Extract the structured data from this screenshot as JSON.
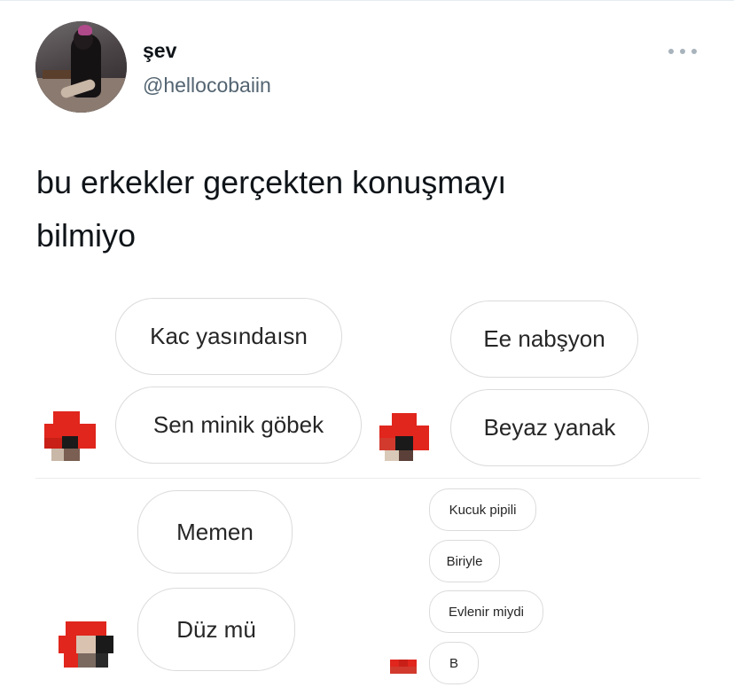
{
  "tweet": {
    "display_name": "şev",
    "handle": "@hellocobaiin",
    "text": "bu erkekler gerçekten konuşmayı\nbilmiyo",
    "more_icon": "more-horizontal-icon"
  },
  "screenshots": {
    "top_left": [
      "Kac yasındaısn",
      "Sen minik göbek"
    ],
    "top_right": [
      "Ee nabşyon",
      "Beyaz yanak"
    ],
    "bottom_left": [
      "Memen",
      "Düz mü"
    ],
    "bottom_right": [
      "Kucuk pipili",
      "Biriyle",
      "Evlenir miydi",
      "B"
    ]
  },
  "colors": {
    "handle": "#536471",
    "bubble_border": "#dbdbdb",
    "censor_red": "#e0261d"
  }
}
